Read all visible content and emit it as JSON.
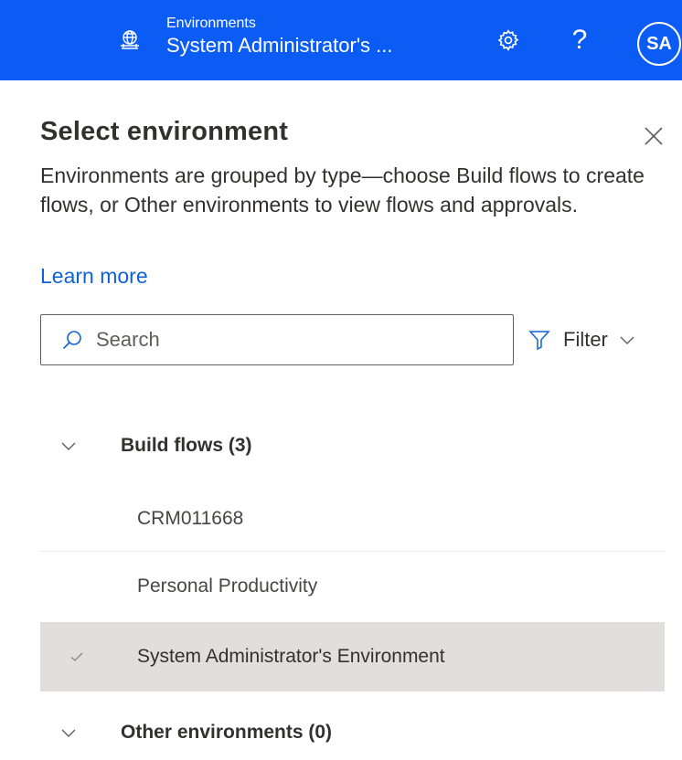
{
  "header": {
    "environment_caption": "Environments",
    "environment_name": "System Administrator's ...",
    "help_label": "?",
    "avatar_initials": "SA",
    "background_color": "#0b5cf4"
  },
  "panel": {
    "title": "Select environment",
    "description": "Environments are grouped by type—choose Build flows to create flows, or Other environments to view flows and approvals.",
    "learn_more": "Learn more",
    "search": {
      "placeholder": "Search",
      "value": ""
    },
    "filter_label": "Filter",
    "groups": [
      {
        "label": "Build flows (3)",
        "expanded": true,
        "items": [
          {
            "label": "CRM011668",
            "selected": false
          },
          {
            "label": "Personal Productivity",
            "selected": false
          },
          {
            "label": "System Administrator's Environment",
            "selected": true
          }
        ]
      },
      {
        "label": "Other environments (0)",
        "expanded": true,
        "items": []
      }
    ]
  },
  "icons": {
    "environment": "globe-building-icon",
    "settings": "gear-icon",
    "close": "close-icon",
    "search": "search-icon",
    "filter": "funnel-icon",
    "chevron": "chevron-down-icon",
    "check": "checkmark-icon"
  },
  "colors": {
    "accent": "#0b5cf4",
    "link": "#0f62d6",
    "selected_row": "#e1dfdd"
  }
}
